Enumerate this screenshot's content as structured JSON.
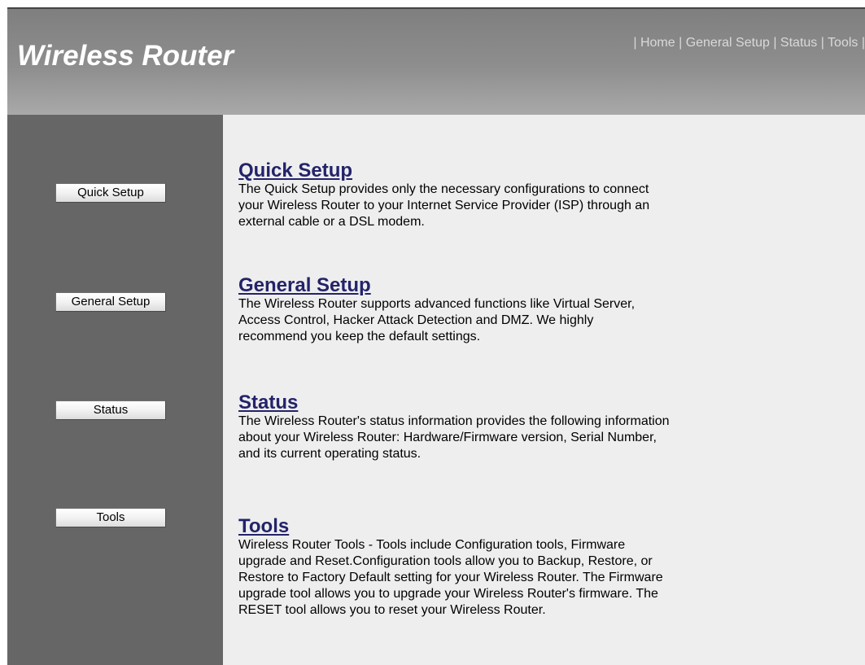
{
  "header": {
    "title": "Wireless Router",
    "nav": [
      {
        "label": "Home"
      },
      {
        "label": "General Setup"
      },
      {
        "label": "Status"
      },
      {
        "label": "Tools"
      }
    ],
    "separator": "|"
  },
  "sidebar": {
    "buttons": [
      {
        "label": "Quick Setup"
      },
      {
        "label": "General Setup"
      },
      {
        "label": "Status"
      },
      {
        "label": "Tools"
      }
    ]
  },
  "sections": [
    {
      "title": "Quick Setup",
      "lines": [
        "The Quick Setup provides only the necessary configurations to connect",
        "your Wireless Router to your Internet Service Provider (ISP) through an",
        "external cable or a DSL modem."
      ]
    },
    {
      "title": "General Setup",
      "lines": [
        "The Wireless Router supports advanced functions like Virtual Server,",
        "Access Control, Hacker Attack Detection and DMZ. We highly",
        "recommend you keep the default settings."
      ]
    },
    {
      "title": "Status",
      "lines": [
        "The Wireless Router's status information provides the following information",
        "about your Wireless Router: Hardware/Firmware version, Serial Number,",
        "and its current operating status."
      ]
    },
    {
      "title": "Tools",
      "lines": [
        "Wireless Router Tools - Tools include Configuration tools, Firmware",
        "upgrade and Reset.Configuration tools allow you to Backup, Restore, or",
        "Restore to Factory Default setting for your Wireless Router. The Firmware",
        "upgrade tool allows you to upgrade your Wireless Router's firmware. The",
        "RESET tool allows you to reset your Wireless Router."
      ]
    }
  ],
  "colors": {
    "header_bg": "#8e8e8e",
    "sidebar_bg": "#666666",
    "content_bg": "#eeeeee",
    "heading": "#23236a",
    "nav_text": "#d9d9d9"
  }
}
